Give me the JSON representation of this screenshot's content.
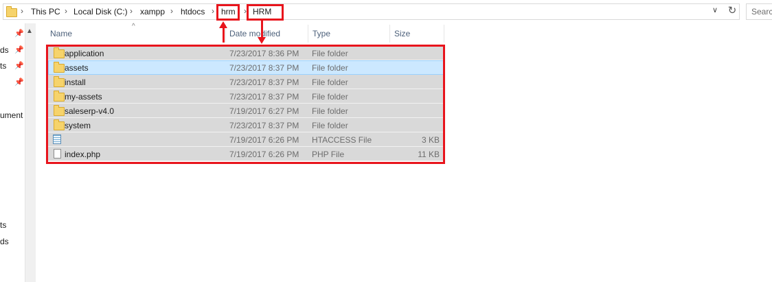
{
  "breadcrumb": [
    {
      "label": "This PC"
    },
    {
      "label": "Local Disk (C:)"
    },
    {
      "label": "xampp"
    },
    {
      "label": "htdocs"
    },
    {
      "label": "hrm"
    },
    {
      "label": "HRM"
    }
  ],
  "search": {
    "placeholder": "Searc"
  },
  "nav": {
    "items": [
      "ds",
      "ts",
      "",
      "ument",
      "ts",
      "ds"
    ]
  },
  "columns": {
    "name": "Name",
    "date": "Date modified",
    "type": "Type",
    "size": "Size"
  },
  "files": [
    {
      "name": "application",
      "date": "7/23/2017 8:36 PM",
      "type": "File folder",
      "size": "",
      "icon": "folder-icon"
    },
    {
      "name": "assets",
      "date": "7/23/2017 8:37 PM",
      "type": "File folder",
      "size": "",
      "icon": "folder-icon",
      "selected": true
    },
    {
      "name": "install",
      "date": "7/23/2017 8:37 PM",
      "type": "File folder",
      "size": "",
      "icon": "folder-icon"
    },
    {
      "name": "my-assets",
      "date": "7/23/2017 8:37 PM",
      "type": "File folder",
      "size": "",
      "icon": "folder-icon"
    },
    {
      "name": "saleserp-v4.0",
      "date": "7/19/2017 6:27 PM",
      "type": "File folder",
      "size": "",
      "icon": "folder-icon"
    },
    {
      "name": "system",
      "date": "7/23/2017 8:37 PM",
      "type": "File folder",
      "size": "",
      "icon": "folder-icon"
    },
    {
      "name": "",
      "date": "7/19/2017 6:26 PM",
      "type": "HTACCESS File",
      "size": "3 KB",
      "icon": "text-file-icon"
    },
    {
      "name": "index.php",
      "date": "7/19/2017 6:26 PM",
      "type": "PHP File",
      "size": "11 KB",
      "icon": "document-icon"
    }
  ],
  "colors": {
    "annotation": "#e8141c",
    "selection": "#cce8ff",
    "row_highlight": "#d9d9d9"
  }
}
